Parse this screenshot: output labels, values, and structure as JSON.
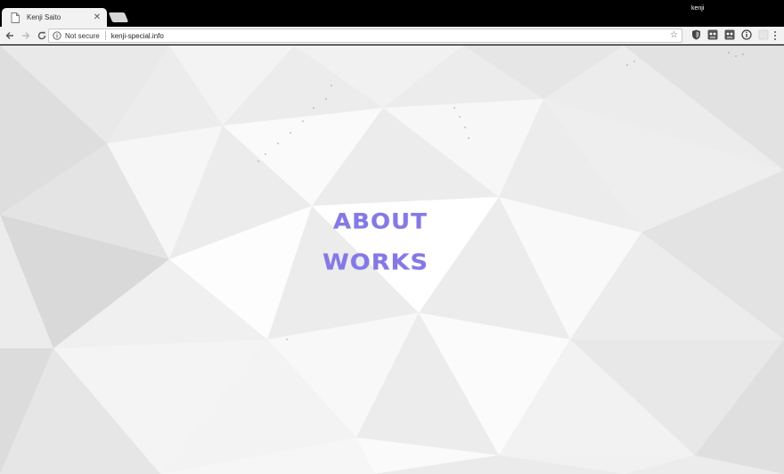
{
  "browser": {
    "tab": {
      "title": "Kenji Saito",
      "favicon": "page-icon",
      "close_icon": "close-icon"
    },
    "new_tab_icon": "new-tab-icon",
    "profile_name": "kenji",
    "toolbar": {
      "back_icon": "back-arrow-icon",
      "forward_icon": "forward-arrow-icon",
      "reload_icon": "reload-icon",
      "security_icon": "info-icon",
      "security_text": "Not secure",
      "url": "kenji-special.info",
      "bookmark_icon": "star-icon",
      "extensions": [
        "shield-extension-icon",
        "ghost-extension-icon",
        "ghost-extension-icon",
        "info-extension-icon",
        "blank-extension-icon"
      ],
      "menu_icon": "menu-dots-icon"
    }
  },
  "page": {
    "background": "low-poly-white-triangles",
    "nav": [
      {
        "label": "ABOUT"
      },
      {
        "label": "WORKS"
      }
    ],
    "accent_color": "#8479e4"
  }
}
